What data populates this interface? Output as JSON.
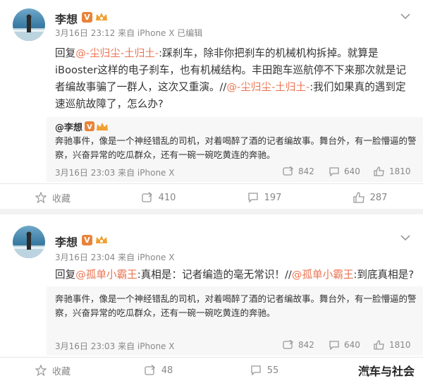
{
  "posts": [
    {
      "username": "李想",
      "meta": "3月16日 23:12 来自 iPhone X   已编辑",
      "reply_prefix": "回复",
      "mention1": "@-尘归尘-土归土-",
      "text_part1": ":踩刹车，除非你把刹车的机械机构拆掉。就算是iBooster这样的电子刹车，也有机械结构。丰田跑车巡航停不下来那次就是记者编故事骗了一群人，这次又重演。//",
      "mention2": "@-尘归尘-土归土-",
      "text_part2": ":我们如果真的遇到定速巡航故障了，怎么办?",
      "repost": {
        "name": "@李想",
        "text": "奔驰事件，像是一个神经错乱的司机，对着喝醉了酒的记者编故事。舞台外，有一脸懵逼的警察，兴奋异常的吃瓜群众，还有一碗一碗吃黄连的奔驰。",
        "meta": "3月16日 23:03 来自 iPhone X",
        "reposts": "842",
        "comments": "640",
        "likes": "1810"
      },
      "actions": {
        "repost": "收藏",
        "comment": "410",
        "like": "197",
        "thumb": "287"
      }
    },
    {
      "username": "李想",
      "meta": "3月16日 23:04 来自 iPhone X",
      "reply_prefix": "回复",
      "mention1": "@孤单小霸王",
      "text_part1": ":真相是：记者编造的毫无常识！//",
      "mention2": "@孤单小霸王",
      "text_part2": ":到底真相是?",
      "repost": {
        "name": "@李想",
        "text": "奔驰事件，像是一个神经错乱的司机，对着喝醉了酒的记者编故事。舞台外，有一脸懵逼的警察，兴奋异常的吃瓜群众，还有一碗一碗吃黄连的奔驰。",
        "meta": "3月16日 23:03 来自 iPhone X",
        "reposts": "842",
        "comments": "640",
        "likes": "1810"
      },
      "actions": {
        "repost": "收藏",
        "comment": "48",
        "like": "55",
        "thumb": ""
      }
    }
  ],
  "watermark": "汽车与社会",
  "badge_v_letter": "V",
  "colors": {
    "mention": "#eb7350",
    "badge": "#e8833a",
    "meta": "#888888",
    "repost_bg": "#f7f7f7"
  }
}
